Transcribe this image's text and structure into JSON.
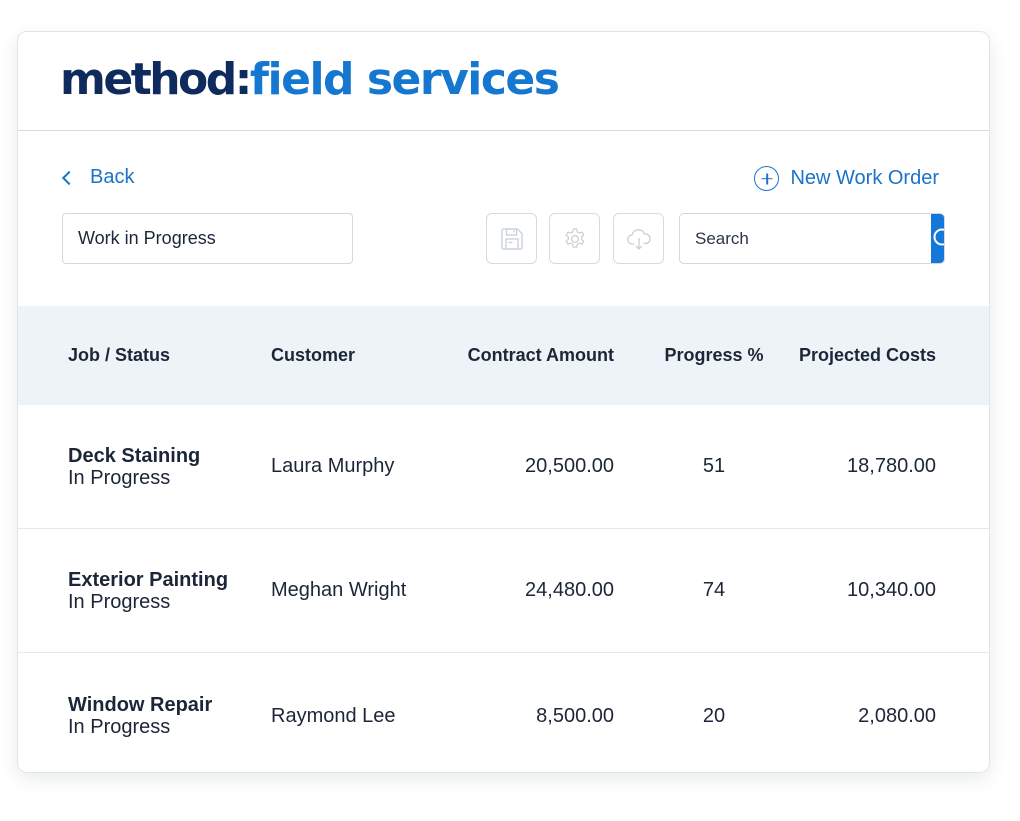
{
  "brand": {
    "logo_part1": "method:",
    "logo_part2": "field services",
    "colors": {
      "dark": "#0f2a5c",
      "accent": "#1577d8"
    }
  },
  "toolbar": {
    "back_label": "Back",
    "new_order_label": "New Work Order",
    "filter_value": "Work in Progress",
    "search_placeholder": "Search",
    "icons": [
      "save-icon",
      "gear-icon",
      "cloud-download-icon",
      "search-icon"
    ]
  },
  "table": {
    "headers": [
      "Job / Status",
      "Customer",
      "Contract Amount",
      "Progress %",
      "Projected Costs"
    ],
    "rows": [
      {
        "job": "Deck Staining",
        "status": "In Progress",
        "customer": "Laura Murphy",
        "contract_amount": "20,500.00",
        "progress": "51",
        "projected_costs": "18,780.00"
      },
      {
        "job": "Exterior Painting",
        "status": "In Progress",
        "customer": "Meghan Wright",
        "contract_amount": "24,480.00",
        "progress": "74",
        "projected_costs": "10,340.00"
      },
      {
        "job": "Window Repair",
        "status": "In Progress",
        "customer": "Raymond Lee",
        "contract_amount": "8,500.00",
        "progress": "20",
        "projected_costs": "2,080.00"
      }
    ]
  }
}
